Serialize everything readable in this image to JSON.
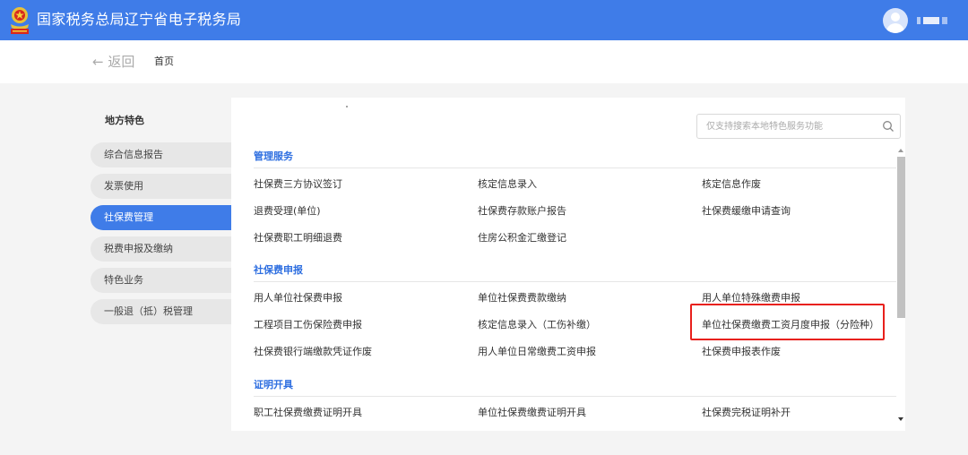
{
  "header": {
    "app_title": "国家税务总局辽宁省电子税务局",
    "emblem_icon": "tax-emblem-icon",
    "avatar_icon": "user-avatar-icon",
    "brand_color": "#3f7ce8"
  },
  "nav": {
    "back_label": "← 返回",
    "breadcrumb_home": "首页"
  },
  "sidebar": {
    "title": "地方特色",
    "active_color": "#3f7ce8",
    "items": [
      {
        "label": "综合信息报告",
        "active": false
      },
      {
        "label": "发票使用",
        "active": false
      },
      {
        "label": "社保费管理",
        "active": true
      },
      {
        "label": "税费申报及缴纳",
        "active": false
      },
      {
        "label": "特色业务",
        "active": false
      },
      {
        "label": "一般退（抵）税管理",
        "active": false
      }
    ]
  },
  "search": {
    "placeholder": "仅支持搜索本地特色服务功能",
    "icon": "search-icon"
  },
  "sections": [
    {
      "title": "管理服务",
      "items": [
        "社保费三方协议签订",
        "核定信息录入",
        "核定信息作废",
        "退费受理(单位)",
        "社保费存款账户报告",
        "社保费缓缴申请查询",
        "社保费职工明细退费",
        "住房公积金汇缴登记"
      ]
    },
    {
      "title": "社保费申报",
      "items": [
        "用人单位社保费申报",
        "单位社保费费款缴纳",
        "用人单位特殊缴费申报",
        "工程项目工伤保险费申报",
        "核定信息录入（工伤补缴）",
        "单位社保费缴费工资月度申报（分险种）",
        "社保费银行端缴款凭证作废",
        "用人单位日常缴费工资申报",
        "社保费申报表作废"
      ]
    },
    {
      "title": "证明开具",
      "items": [
        "职工社保费缴费证明开具",
        "单位社保费缴费证明开具",
        "社保费完税证明补开"
      ]
    }
  ],
  "highlight": {
    "item": "单位社保费缴费工资月度申报（分险种）",
    "color": "#e8201c"
  }
}
